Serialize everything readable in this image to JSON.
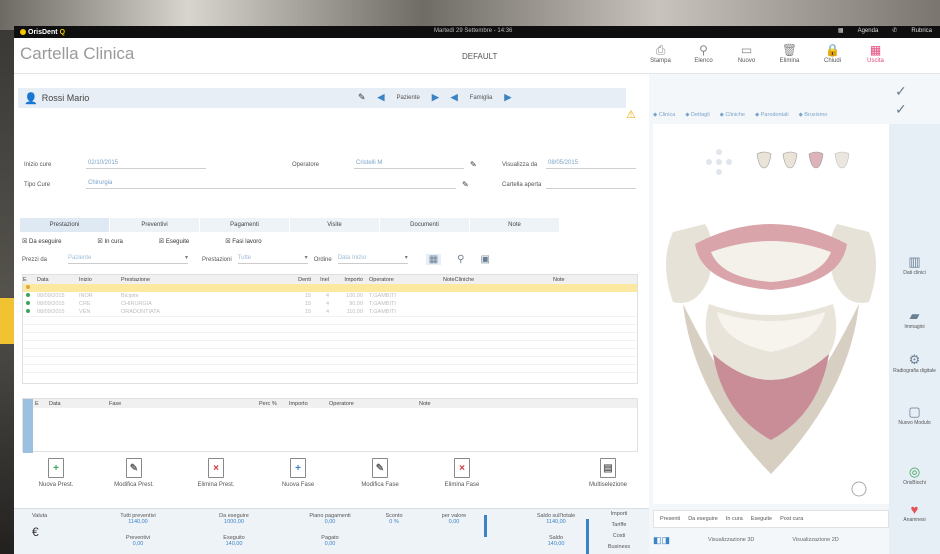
{
  "titlebar": {
    "brand": "OrisDent",
    "brand_q": "Q",
    "date": "Martedì 29 Settembre - 14:36",
    "agenda": "Agenda",
    "rubrica": "Rubrica"
  },
  "header": {
    "title": "Cartella Clinica",
    "profile": "DEFAULT",
    "tools": [
      {
        "label": "Stampa",
        "icon": "printer-icon"
      },
      {
        "label": "Elenco",
        "icon": "search-icon"
      },
      {
        "label": "Nuovo",
        "icon": "new-doc-icon"
      },
      {
        "label": "Elimina",
        "icon": "trash-icon"
      },
      {
        "label": "Chiudi",
        "icon": "lock-icon"
      },
      {
        "label": "Uscita",
        "icon": "grid-icon"
      }
    ]
  },
  "patient": {
    "name": "Rossi Mario",
    "nav_patient": "Paziente",
    "nav_family": "Famiglia"
  },
  "form": {
    "inizio_label": "Inizio cure",
    "inizio_value": "02/10/2015",
    "operatore_label": "Operatore",
    "operatore_value": "Cristelli M",
    "visualizza_label": "Visualizza da",
    "visualizza_value": "08/05/2015",
    "tipo_label": "Tipo Cure",
    "tipo_value": "Chirurgia",
    "cartella_label": "Cartella aperta"
  },
  "tabs": [
    "Prestazioni",
    "Preventivi",
    "Pagamenti",
    "Visite",
    "Documenti",
    "Note"
  ],
  "filters": [
    "Da eseguire",
    "In cura",
    "Eseguite",
    "Fasi lavoro"
  ],
  "filters2": {
    "prezzo_label": "Prezzi da",
    "prezzo_value": "Paziente",
    "prestazioni_label": "Prestazioni",
    "prestazioni_value": "Tutte",
    "ordine_label": "Ordine",
    "ordine_value": "Data Inizio"
  },
  "grid": {
    "headers": [
      "E",
      "Data",
      "Inizio",
      "Prestazione",
      "Denti",
      "Inel",
      "Importo",
      "Operatore",
      "NoteCliniche",
      "Note"
    ],
    "rows": [
      {
        "dot": "#e8a63a",
        "data": "",
        "inizio": "",
        "prest": "",
        "denti": "",
        "inel": "",
        "imp": "",
        "op": "",
        "selected": true
      },
      {
        "dot": "#3aa55a",
        "data": "08/09/2015",
        "inizio": "INOR",
        "prest": "Bicipite",
        "denti": "15",
        "inel": "4",
        "imp": "100,00",
        "op": "T.GAMBITI",
        "selected": false
      },
      {
        "dot": "#3aa55a",
        "data": "08/09/2015",
        "inizio": "CRE",
        "prest": "CHIRURGIA",
        "denti": "15",
        "inel": "4",
        "imp": "90,00",
        "op": "T.GAMBITI",
        "selected": false
      },
      {
        "dot": "#3aa55a",
        "data": "08/09/2015",
        "inizio": "VEN",
        "prest": "ORADONTIATA",
        "denti": "15",
        "inel": "4",
        "imp": "110,00",
        "op": "T.GAMBITI",
        "selected": false
      }
    ]
  },
  "grid2": {
    "headers": [
      "E",
      "Data",
      "Fase",
      "Perc %",
      "Importo",
      "Operatore",
      "Note"
    ]
  },
  "actions": [
    {
      "label": "Nuova Prest.",
      "glyph": "+",
      "color": "g",
      "icon": "new-prest-icon"
    },
    {
      "label": "Modifica Prest.",
      "glyph": "✎",
      "color": "k",
      "icon": "edit-prest-icon"
    },
    {
      "label": "Elimina Prest.",
      "glyph": "×",
      "color": "r",
      "icon": "delete-prest-icon"
    },
    {
      "label": "Nuova Fase",
      "glyph": "+",
      "color": "b",
      "icon": "new-phase-icon"
    },
    {
      "label": "Modifica Fase",
      "glyph": "✎",
      "color": "k",
      "icon": "edit-phase-icon"
    },
    {
      "label": "Elimina Fase",
      "glyph": "×",
      "color": "r",
      "icon": "delete-phase-icon"
    },
    {
      "label": "Multiselezione",
      "glyph": "▤",
      "color": "k",
      "icon": "multiselect-icon"
    }
  ],
  "totals": {
    "valuta": "Valuta",
    "currency": "€",
    "cells": [
      {
        "label": "Tutti preventivi",
        "value": "1140,00"
      },
      {
        "label": "Da eseguire",
        "value": "1000,00"
      },
      {
        "label": "Piano pagamenti",
        "value": "0,00"
      },
      {
        "label": "Sconto",
        "value": "0 %"
      },
      {
        "label": "per valore",
        "value": "0,00"
      },
      {
        "label": "Saldo sull'totale",
        "value": "1140,00"
      },
      {
        "label": "Preventivi",
        "value": "0,00"
      },
      {
        "label": "Eseguito",
        "value": "140,00"
      },
      {
        "label": "Pagato",
        "value": "0,00"
      },
      {
        "label": "Saldo",
        "value": "140,00"
      }
    ],
    "buttons": [
      "Importi",
      "Tariffe",
      "Costi",
      "Business"
    ]
  },
  "breadcrumb": [
    "Clinica",
    "Dettagli",
    "Cliniche",
    "Parodontali",
    "Bruxismo"
  ],
  "bottom_tabs": [
    "Presenti",
    "Da eseguire",
    "In cura",
    "Eseguite",
    "Post cura"
  ],
  "visualizza": [
    "Visualizzazione 3D",
    "Visualizzazione 2D"
  ],
  "sidebar": [
    {
      "label": "Dati clinici",
      "icon": "clinical-data-icon",
      "glyph": "▥"
    },
    {
      "label": "Immagini",
      "icon": "images-icon",
      "glyph": "▰"
    },
    {
      "label": "Radiografia digitale",
      "icon": "xray-icon",
      "glyph": "⚙"
    },
    {
      "label": "Nuovo Modulo",
      "icon": "new-module-icon",
      "glyph": "▢"
    },
    {
      "label": "OrisBiochi",
      "icon": "orisbiochi-icon",
      "glyph": "◎"
    },
    {
      "label": "Anamnesi",
      "icon": "anamnesi-icon",
      "glyph": "♥"
    }
  ],
  "colors": {
    "accent": "#3b83c4",
    "highlight": "#fbe9a2",
    "warning": "#f0a400",
    "danger": "#e5457a"
  }
}
